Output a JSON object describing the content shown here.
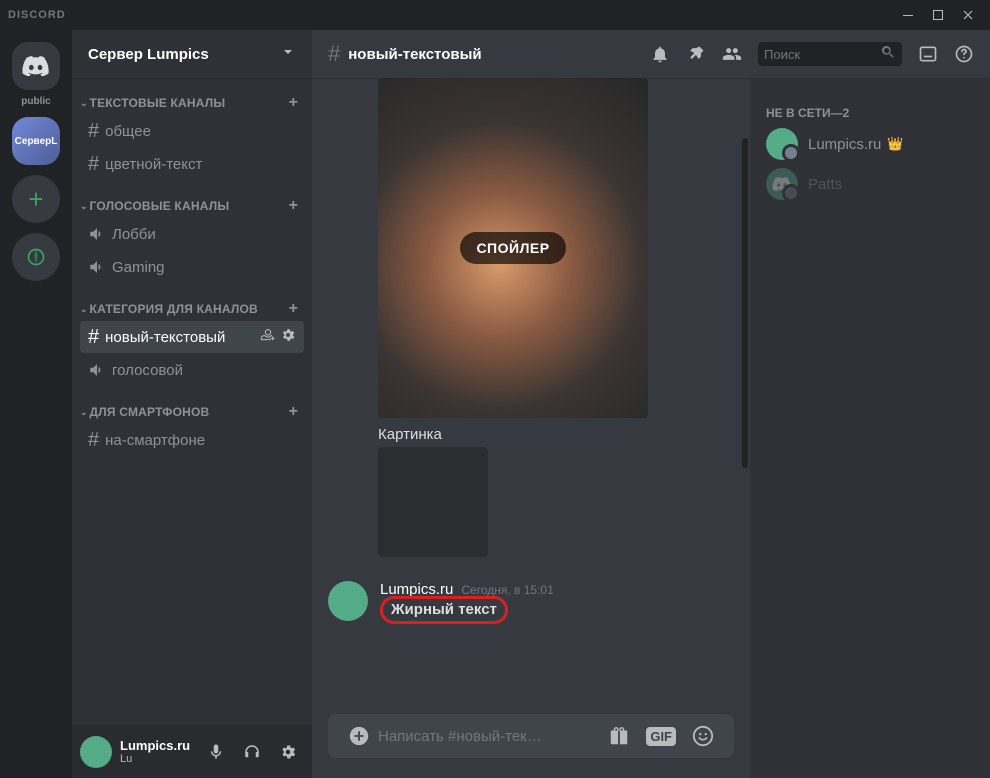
{
  "titlebar": {
    "logo": "DISCORD"
  },
  "guilds": {
    "public_label": "public",
    "server_abbr": "СерверL"
  },
  "server": {
    "name": "Сервер Lumpics"
  },
  "categories": [
    {
      "name": "ТЕКСТОВЫЕ КАНАЛЫ",
      "channels": [
        {
          "name": "общее",
          "type": "text",
          "selected": false
        },
        {
          "name": "цветной-текст",
          "type": "text",
          "selected": false
        }
      ]
    },
    {
      "name": "ГОЛОСОВЫЕ КАНАЛЫ",
      "channels": [
        {
          "name": "Лобби",
          "type": "voice",
          "selected": false
        },
        {
          "name": "Gaming",
          "type": "voice",
          "selected": false
        }
      ]
    },
    {
      "name": "КАТЕГОРИЯ ДЛЯ КАНАЛОВ",
      "channels": [
        {
          "name": "новый-текстовый",
          "type": "text",
          "selected": true
        },
        {
          "name": "голосовой",
          "type": "voice",
          "selected": false
        }
      ]
    },
    {
      "name": "ДЛЯ СМАРТФОНОВ",
      "channels": [
        {
          "name": "на-смартфоне",
          "type": "text",
          "selected": false
        }
      ]
    }
  ],
  "user_panel": {
    "name": "Lumpics.ru",
    "tag": "Lu"
  },
  "chat": {
    "channel_name": "новый-текстовый",
    "search_placeholder": "Поиск",
    "spoiler_label": "СПОЙЛЕР",
    "caption": "Картинка",
    "message": {
      "author": "Lumpics.ru",
      "timestamp": "Сегодня, в 15:01",
      "text": "Жирный текст"
    },
    "composer_placeholder": "Написать #новый-тек…",
    "gif_label": "GIF"
  },
  "members": {
    "offline_header": "НЕ В СЕТИ—2",
    "items": [
      {
        "name": "Lumpics.ru",
        "owner": true,
        "dim": false,
        "avatar": "user"
      },
      {
        "name": "Patts",
        "owner": false,
        "dim": true,
        "avatar": "discord"
      }
    ]
  }
}
